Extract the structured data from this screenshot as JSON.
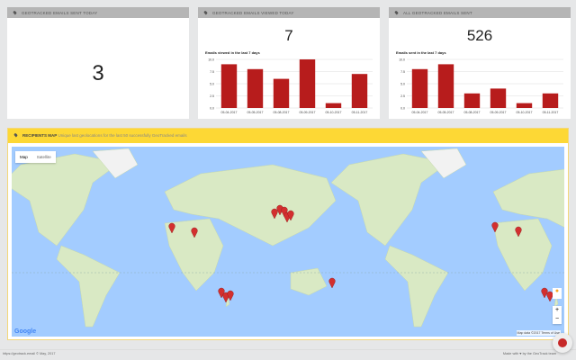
{
  "cards": [
    {
      "title": "GEOTRACKED EMAILS SENT TODAY",
      "value": "3"
    },
    {
      "title": "GEOTRACKED EMAILS VIEWED TODAY",
      "value": "7"
    },
    {
      "title": "ALL GEOTRACKED EMAILS SENT",
      "value": "526"
    }
  ],
  "chart_data": [
    {
      "type": "bar",
      "title": "Emails viewed in the last 7 days",
      "categories": [
        "05-04-2017",
        "05-05-2017",
        "05-08-2017",
        "05-09-2017",
        "05-10-2017",
        "05-11-2017"
      ],
      "values": [
        9,
        8,
        6,
        10,
        1,
        7
      ],
      "yticks": [
        "0.0",
        "2.5",
        "5.0",
        "7.5",
        "10.0"
      ],
      "ylim": [
        0,
        10
      ],
      "color": "#b71c1c"
    },
    {
      "type": "bar",
      "title": "Emails sent in the last 7 days",
      "categories": [
        "05-04-2017",
        "05-05-2017",
        "05-08-2017",
        "05-09-2017",
        "05-10-2017",
        "05-11-2017"
      ],
      "values": [
        8,
        9,
        3,
        4,
        1,
        3
      ],
      "yticks": [
        "0.0",
        "2.5",
        "5.0",
        "7.5",
        "10.0"
      ],
      "ylim": [
        0,
        10
      ],
      "color": "#b71c1c"
    }
  ],
  "map": {
    "title": "RECIPIENTS MAP",
    "subtitle": "Unique last geolocations for the last 50 successfully GeoTracked emails",
    "tab_map": "Map",
    "tab_satellite": "Satellite",
    "google": "Google",
    "attribution": "Map data ©2017   Terms of Use",
    "zoom_in": "+",
    "zoom_out": "−"
  },
  "footer": {
    "left": "https://geotrack.email © May, 2017",
    "right": "Made with ♥ by the GeoTrack team"
  }
}
